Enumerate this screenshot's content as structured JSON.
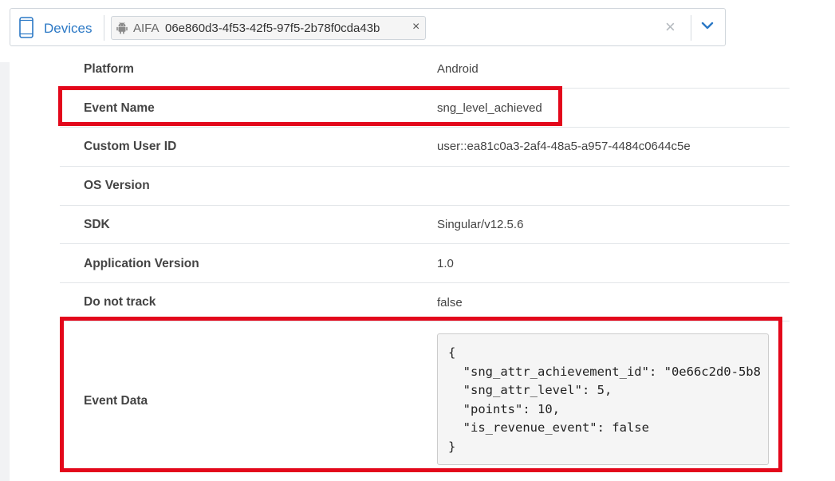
{
  "filter": {
    "scope_label": "Devices",
    "scope_icon": "phone-icon",
    "chip": {
      "platform_icon": "android-icon",
      "type": "AIFA",
      "value": "06e860d3-4f53-42f5-97f5-2b78f0cda43b",
      "remove_symbol": "×"
    },
    "clear_symbol": "×",
    "dropdown_icon": "chevron-down-icon"
  },
  "details": [
    {
      "label": "Platform",
      "value": "Android"
    },
    {
      "label": "Event Name",
      "value": "sng_level_achieved"
    },
    {
      "label": "Custom User ID",
      "value": "user::ea81c0a3-2af4-48a5-a957-4484c0644c5e"
    },
    {
      "label": "OS Version",
      "value": ""
    },
    {
      "label": "SDK",
      "value": "Singular/v12.5.6"
    },
    {
      "label": "Application Version",
      "value": "1.0"
    },
    {
      "label": "Do not track",
      "value": "false"
    }
  ],
  "event_data": {
    "label": "Event Data",
    "json_text": "{\n  \"sng_attr_achievement_id\": \"0e66c2d0-5b8\n  \"sng_attr_level\": 5,\n  \"points\": 10,\n  \"is_revenue_event\": false\n}"
  },
  "colors": {
    "accent": "#2b78c5",
    "highlight": "#e3071b"
  }
}
